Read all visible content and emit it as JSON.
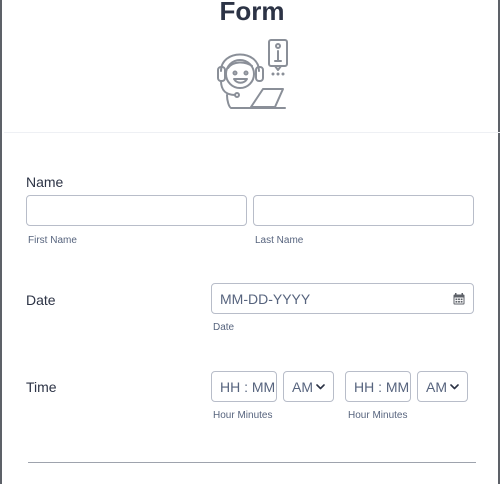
{
  "header": {
    "title": "Form",
    "logo_icon": "support-agent-icon"
  },
  "name_field": {
    "label": "Name",
    "first": {
      "value": "",
      "sublabel": "First Name"
    },
    "last": {
      "value": "",
      "sublabel": "Last Name"
    }
  },
  "date_field": {
    "label": "Date",
    "placeholder": "MM-DD-YYYY",
    "sublabel": "Date",
    "icon": "calendar-icon"
  },
  "time_field": {
    "label": "Time",
    "start": {
      "time_placeholder": "HH : MM",
      "ampm": "AM",
      "sublabel": "Hour Minutes"
    },
    "end": {
      "time_placeholder": "HH : MM",
      "ampm": "AM",
      "sublabel": "Hour Minutes"
    }
  }
}
